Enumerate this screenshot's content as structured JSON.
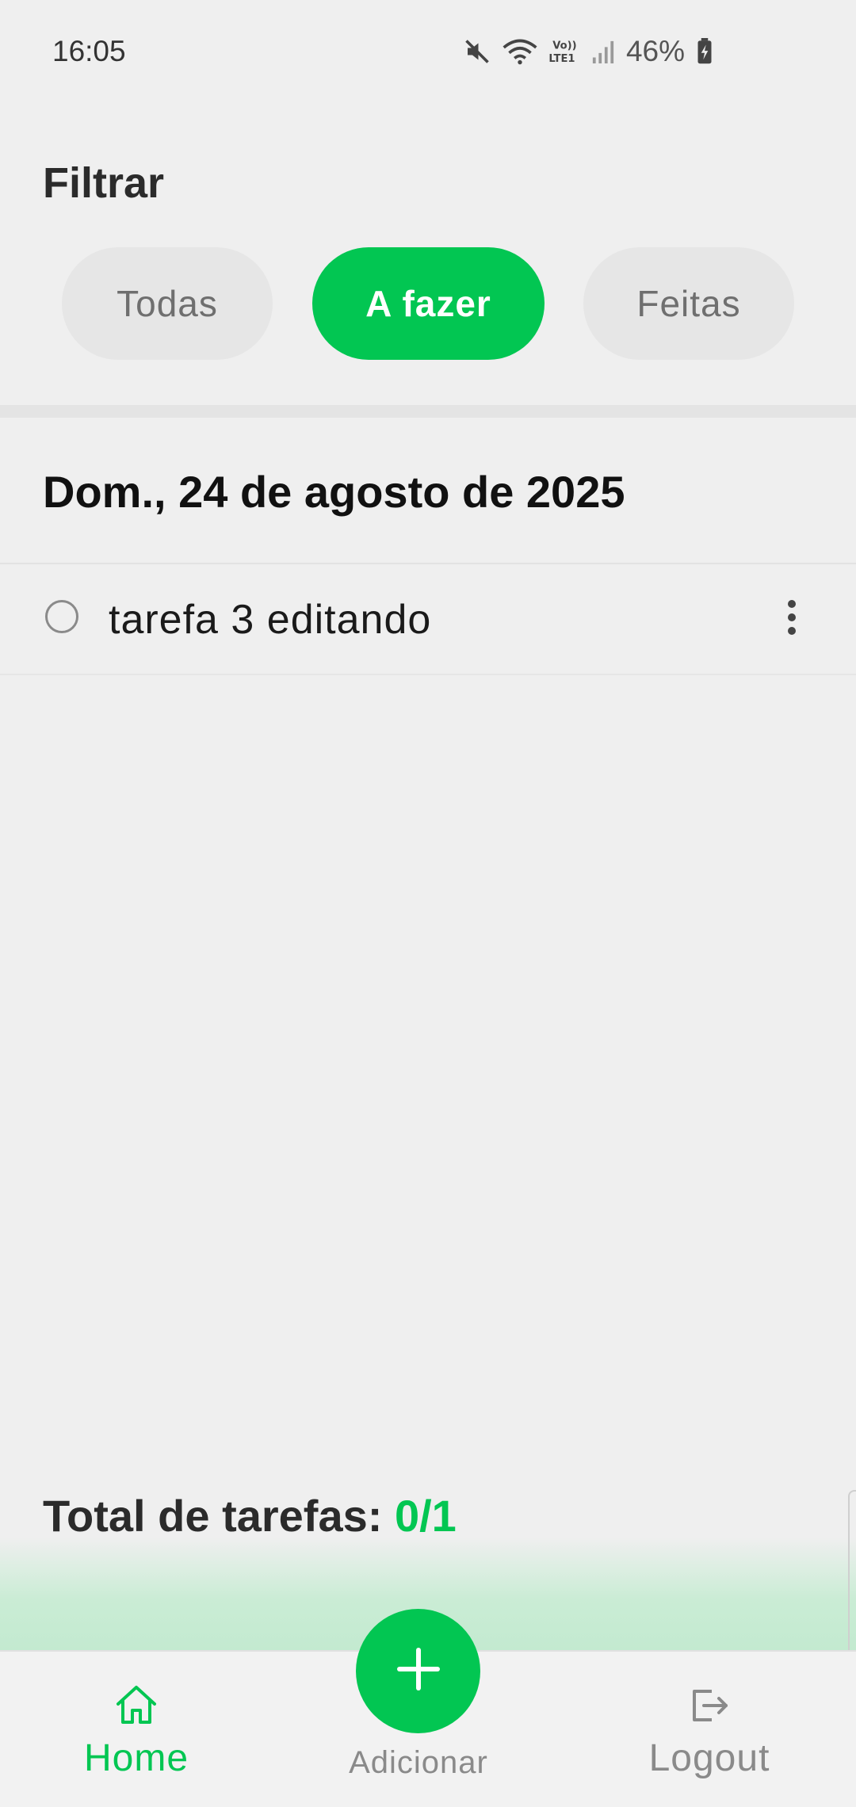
{
  "status_bar": {
    "time": "16:05",
    "battery": "46%",
    "icons": [
      "mute-icon",
      "wifi-icon",
      "volte-lte-icon",
      "signal-icon",
      "battery-charging-icon"
    ]
  },
  "filter": {
    "title": "Filtrar",
    "chips": [
      {
        "label": "Todas",
        "active": false
      },
      {
        "label": "A fazer",
        "active": true
      },
      {
        "label": "Feitas",
        "active": false
      }
    ]
  },
  "date_heading": "Dom., 24 de agosto de 2025",
  "tasks": [
    {
      "label": "tarefa 3 editando",
      "done": false
    }
  ],
  "total": {
    "label": "Total de tarefas: ",
    "count": "0/1"
  },
  "bottom_nav": {
    "home_label": "Home",
    "add_label": "Adicionar",
    "logout_label": "Logout"
  },
  "colors": {
    "accent": "#02c652",
    "background": "#efefef",
    "chip_inactive": "#e6e6e6"
  }
}
